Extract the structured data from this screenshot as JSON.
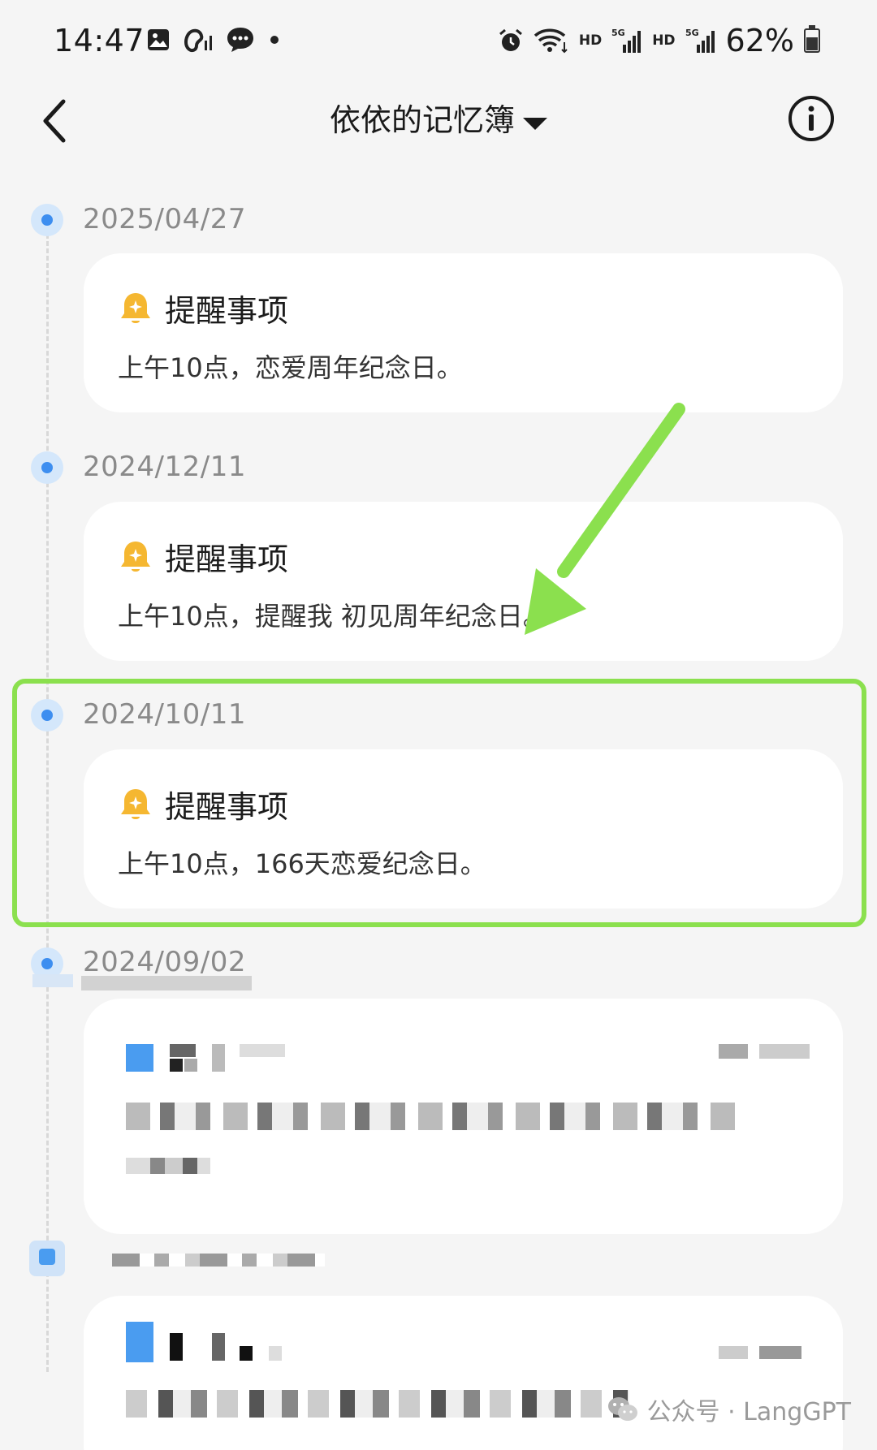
{
  "status_bar": {
    "time": "14:47",
    "battery": "62%",
    "battery_level": 0.62,
    "hd_label": "HD",
    "network_label": "5G",
    "left_icons": [
      "gallery-icon",
      "hearing-aid-icon",
      "chat-bubble-icon",
      "dot-icon"
    ],
    "right_icons": [
      "alarm-icon",
      "wifi-icon",
      "signal-icon",
      "signal-icon",
      "battery-icon"
    ]
  },
  "header": {
    "title": "依依的记忆簿",
    "back_icon": "chevron-left-icon",
    "info_icon": "info-icon",
    "dropdown_icon": "caret-down-icon"
  },
  "timeline": [
    {
      "date": "2025/04/27",
      "card_title": "提醒事项",
      "card_body": "上午10点，恋爱周年纪念日。",
      "icon": "bell-icon"
    },
    {
      "date": "2024/12/11",
      "card_title": "提醒事项",
      "card_body": "上午10点，提醒我 初见周年纪念日。",
      "icon": "bell-icon"
    },
    {
      "date": "2024/10/11",
      "card_title": "提醒事项",
      "card_body": "上午10点，166天恋爱纪念日。",
      "icon": "bell-icon",
      "highlighted": true
    },
    {
      "date": "2024/09/02"
    }
  ],
  "watermark": {
    "text": "公众号 · LangGPT",
    "icon": "wechat-icon"
  },
  "colors": {
    "accent_blue": "#3d8ef0",
    "highlight_green": "#8be04e",
    "bell_yellow": "#f5b731",
    "background": "#f5f5f5"
  }
}
